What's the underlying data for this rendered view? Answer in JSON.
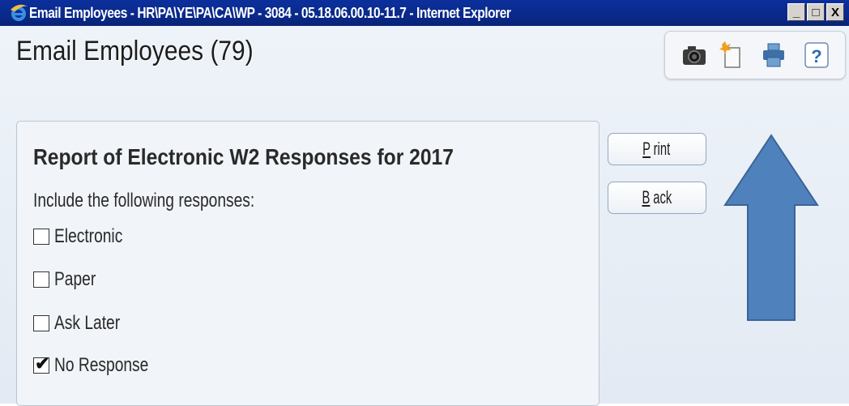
{
  "window": {
    "title": "Email Employees - HR\\PA\\YE\\PA\\CA\\WP - 3084 - 05.18.06.00.10-11.7 - Internet Explorer",
    "minimize_label": "_",
    "maximize_label": "□",
    "close_label": "X"
  },
  "page": {
    "title": "Email Employees (79)"
  },
  "toolbar": {
    "icons": [
      "camera-icon",
      "new-document-icon",
      "printer-icon",
      "help-icon"
    ],
    "help_label": "?"
  },
  "report": {
    "title": "Report of Electronic W2 Responses for 2017",
    "include_label": "Include the following responses:",
    "options": [
      {
        "label": "Electronic",
        "checked": false
      },
      {
        "label": "Paper",
        "checked": false
      },
      {
        "label": "Ask Later",
        "checked": false
      },
      {
        "label": "No Response",
        "checked": true
      }
    ]
  },
  "buttons": {
    "print_first": "P",
    "print_rest": "rint",
    "back_first": "B",
    "back_rest": "ack"
  },
  "colors": {
    "titlebar": "#0a2a8a",
    "annotation_arrow": "#4f81bd"
  }
}
